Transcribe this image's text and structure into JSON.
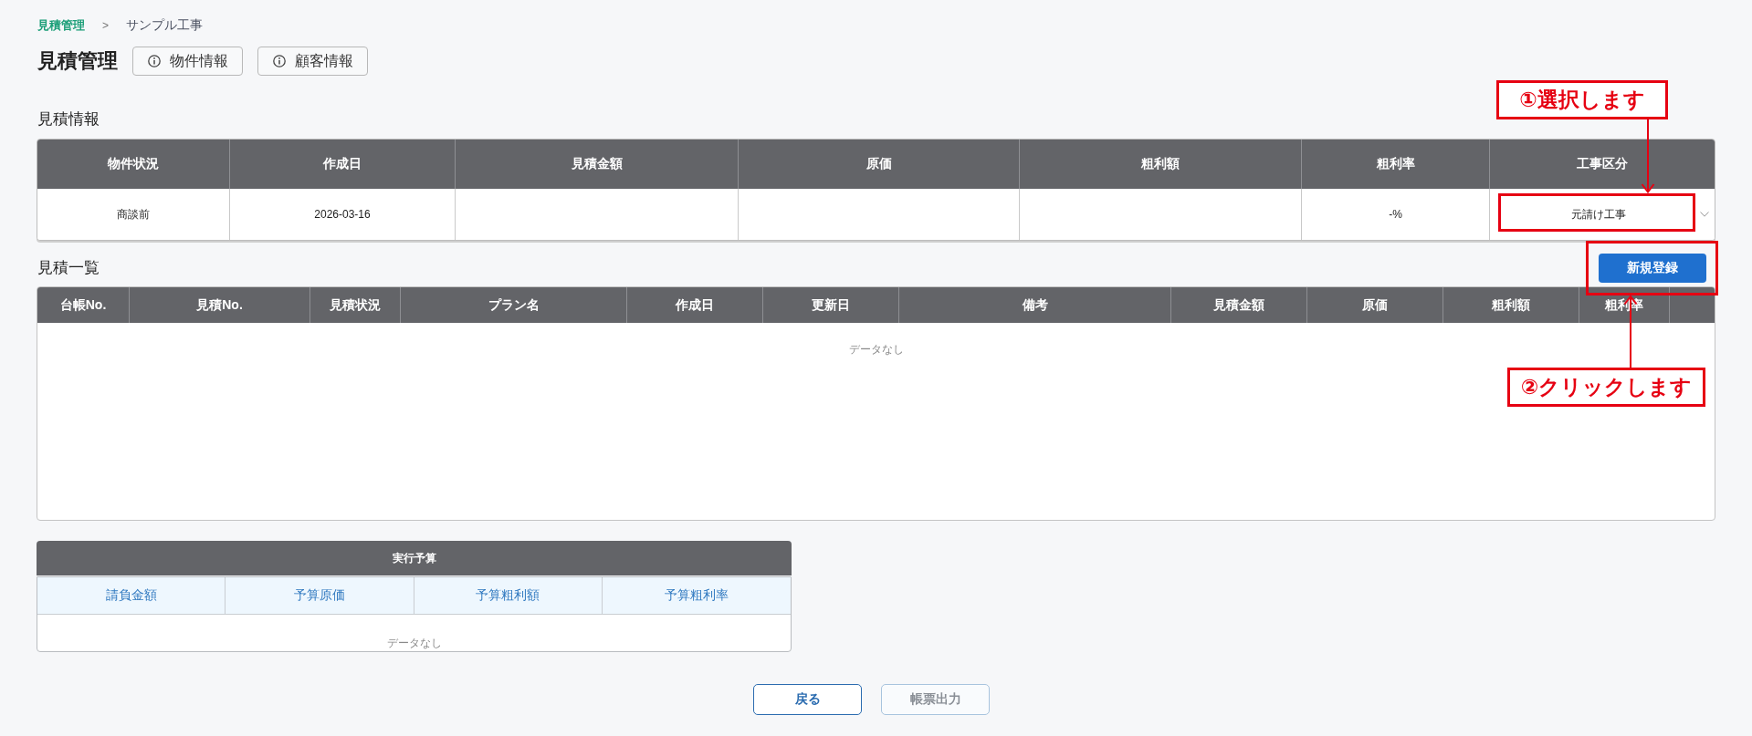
{
  "breadcrumb": {
    "items": [
      {
        "label": "見積管理",
        "current": false
      },
      {
        "label": "サンプル工事",
        "current": true
      }
    ],
    "separator": ">"
  },
  "header": {
    "title": "見積管理",
    "buttons": [
      "物件情報",
      "顧客情報"
    ]
  },
  "estimate_info": {
    "title": "見積情報",
    "columns": [
      "物件状況",
      "作成日",
      "見積金額",
      "原価",
      "粗利額",
      "粗利率",
      "工事区分"
    ],
    "row": [
      {
        "kind": "text",
        "value": "商談前"
      },
      {
        "kind": "text",
        "value": "2026-03-16"
      },
      {
        "kind": "blank"
      },
      {
        "kind": "blank"
      },
      {
        "kind": "blank"
      },
      {
        "kind": "text",
        "value": "-%"
      },
      {
        "kind": "select",
        "value": "元請け工事"
      }
    ]
  },
  "estimate_list": {
    "title": "見積一覧",
    "new_button": "新規登録",
    "columns": [
      "台帳No.",
      "見積No.",
      "見積状況",
      "プラン名",
      "作成日",
      "更新日",
      "備考",
      "見積金額",
      "原価",
      "粗利額",
      "粗利率"
    ],
    "empty_text": "データなし"
  },
  "budget": {
    "title": "実行予算",
    "columns": [
      "請負金額",
      "予算原価",
      "予算粗利額",
      "予算粗利率"
    ],
    "empty_text": "データなし"
  },
  "footer_buttons": [
    {
      "label": "戻る",
      "disabled": false
    },
    {
      "label": "帳票出力",
      "disabled": true
    }
  ],
  "annotations": [
    {
      "text": "①選択します"
    },
    {
      "text": "②クリックします"
    }
  ]
}
